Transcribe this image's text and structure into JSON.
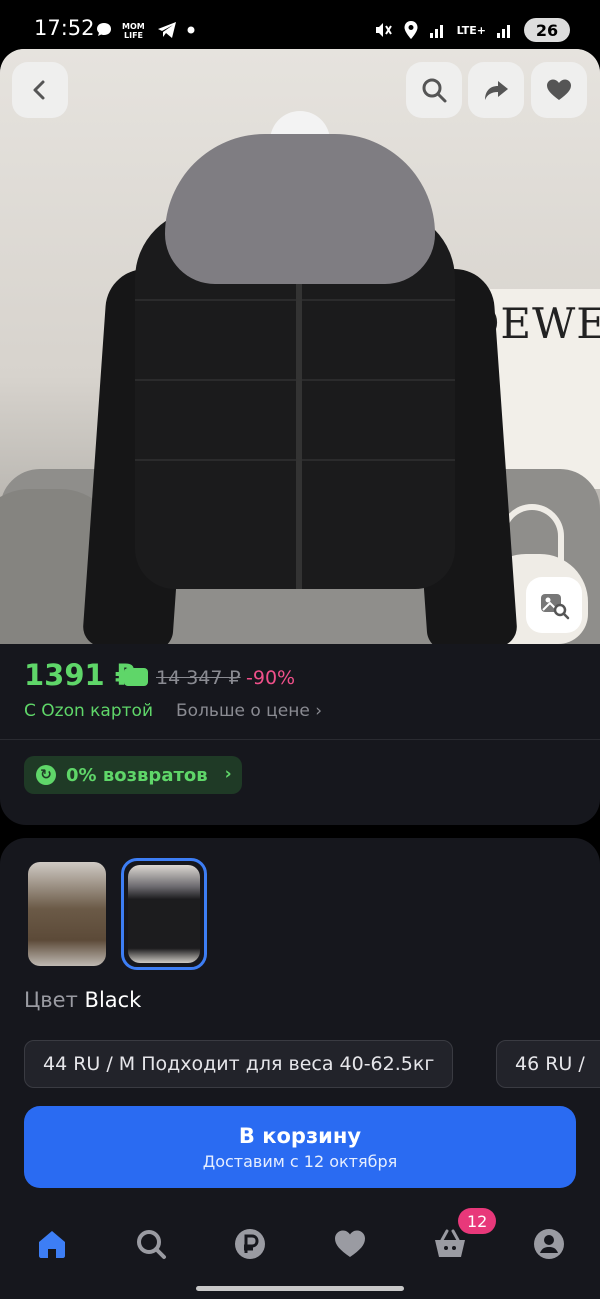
{
  "statusbar": {
    "time": "17:52",
    "network": "LTE+",
    "battery": "26",
    "icons": [
      "chat-icon",
      "momlife-icon",
      "telegram-icon",
      "dot-icon",
      "mute-icon",
      "location-icon",
      "signal-icon",
      "battery-icon"
    ]
  },
  "photo": {
    "poster_text": "OEWE",
    "buttons": [
      "back-icon",
      "search-icon",
      "share-icon",
      "heart-icon",
      "visual-search-icon"
    ]
  },
  "price": {
    "current": "1391 ₽",
    "old": "14 347 ₽",
    "discount": "-90%",
    "ozon_card_label": "С Ozon картой",
    "more_link": "Больше о цене",
    "accent_green": "#5fd669",
    "discount_pink": "#f0508a"
  },
  "returns": {
    "label": "0% возвратов"
  },
  "variants": {
    "color_label": "Цвет",
    "color_value": "Black",
    "sizes": [
      "44 RU / M Подходит для веса 40-62.5кг",
      "46 RU /"
    ]
  },
  "cart": {
    "label": "В корзину",
    "delivery": "Доставим с 12 октября",
    "accent_blue": "#2a6bf2"
  },
  "bottomnav": {
    "items": [
      "home-icon",
      "search-icon",
      "ruble-icon",
      "heart-icon",
      "cart-icon",
      "profile-icon"
    ],
    "cart_badge": "12"
  }
}
